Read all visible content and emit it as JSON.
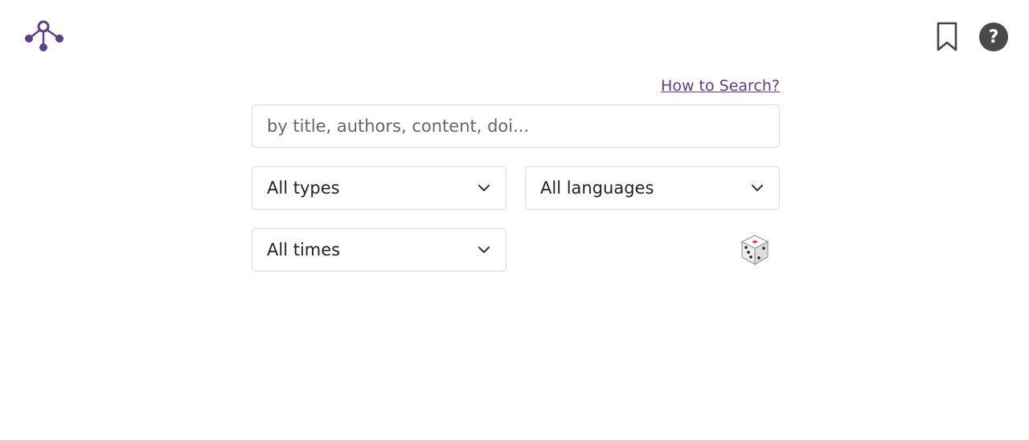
{
  "header": {
    "logo_icon": "network-logo-icon",
    "bookmark_icon": "bookmark-icon",
    "help_icon": "help-circle-icon",
    "help_glyph": "?",
    "brand_color": "#5b3e8f"
  },
  "search": {
    "howto_label": "How to Search?",
    "placeholder": "by title, authors, content, doi..."
  },
  "filters": {
    "type_selected": "All types",
    "language_selected": "All languages",
    "time_selected": "All times",
    "random_icon": "dice-icon"
  }
}
